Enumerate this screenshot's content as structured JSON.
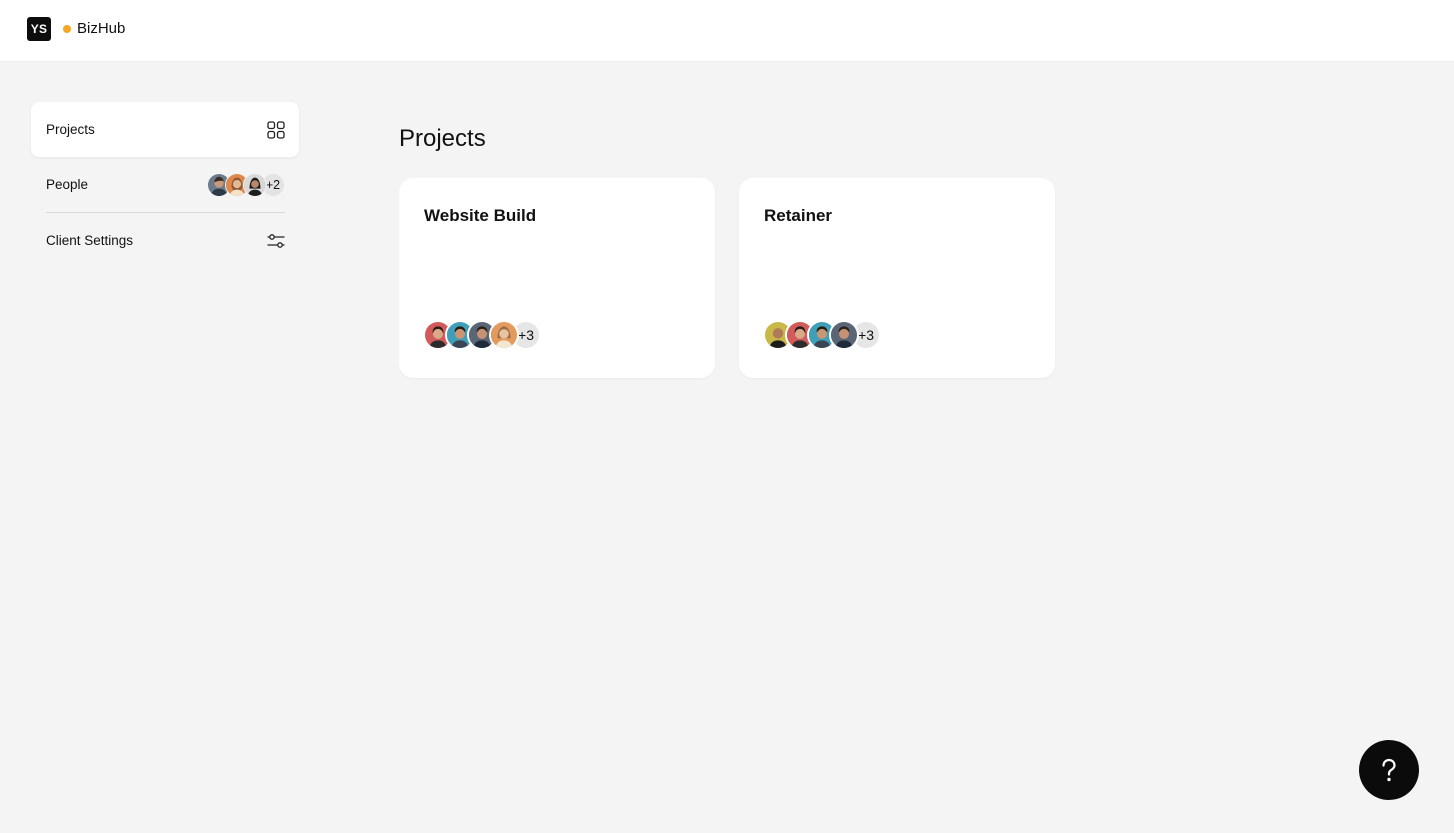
{
  "header": {
    "logo_text": "YS",
    "brand_name": "BizHub",
    "status_color": "#f5a623"
  },
  "sidebar": {
    "items": [
      {
        "label": "Projects",
        "icon": "grid-icon",
        "active": true
      },
      {
        "label": "People",
        "icon": "avatar-stack",
        "more": "+2"
      },
      {
        "label": "Client Settings",
        "icon": "sliders-icon"
      }
    ]
  },
  "main": {
    "title": "Projects",
    "projects": [
      {
        "name": "Website Build",
        "more_members": "+3"
      },
      {
        "name": "Retainer",
        "more_members": "+3"
      }
    ]
  },
  "help": {
    "label": "?",
    "icon": "help-icon"
  },
  "colors": {
    "background": "#f4f4f4",
    "surface": "#ffffff",
    "accent": "#0b0b0b",
    "status_dot": "#f5a623"
  }
}
